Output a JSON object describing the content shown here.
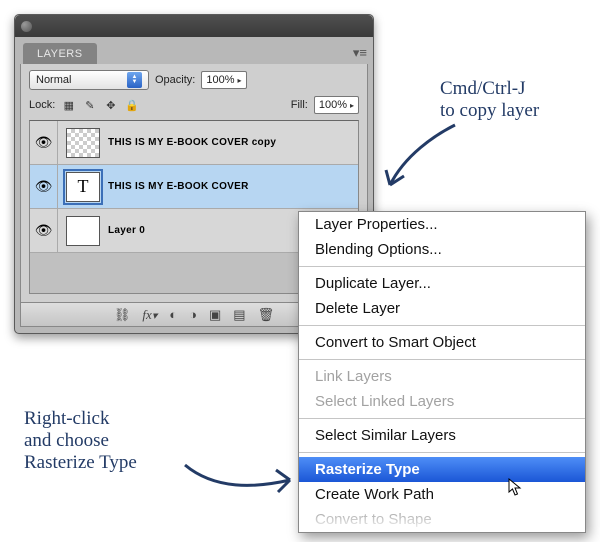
{
  "panel": {
    "tab": "LAYERS",
    "blend_label": "Normal",
    "opacity_label": "Opacity:",
    "opacity_value": "100%",
    "lock_label": "Lock:",
    "fill_label": "Fill:",
    "fill_value": "100%"
  },
  "layers": [
    {
      "name": "THIS IS  MY  E-BOOK COVER copy"
    },
    {
      "name": "THIS IS  MY  E-BOOK COVER"
    },
    {
      "name": "Layer 0"
    }
  ],
  "context_menu": {
    "items": [
      {
        "label": "Layer Properties..."
      },
      {
        "label": "Blending Options..."
      },
      {
        "sep": true
      },
      {
        "label": "Duplicate Layer..."
      },
      {
        "label": "Delete Layer"
      },
      {
        "sep": true
      },
      {
        "label": "Convert to Smart Object"
      },
      {
        "sep": true
      },
      {
        "label": "Link Layers",
        "disabled": true
      },
      {
        "label": "Select Linked Layers",
        "disabled": true
      },
      {
        "sep": true
      },
      {
        "label": "Select Similar Layers"
      },
      {
        "sep": true
      },
      {
        "label": "Rasterize Type",
        "highlight": true
      },
      {
        "label": "Create Work Path"
      },
      {
        "label": "Convert to Shape",
        "disabled": true
      }
    ]
  },
  "annotations": {
    "top": "Cmd/Ctrl-J\nto copy layer",
    "bottom": "Right-click\nand choose\nRasterize Type"
  }
}
